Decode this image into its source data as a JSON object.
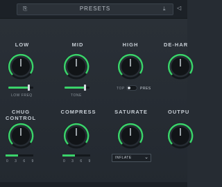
{
  "header": {
    "presets_label": "PRESETS",
    "icons": [
      "save-icon",
      "download-icon",
      "back-icon"
    ]
  },
  "controls": {
    "low": {
      "label": "LOW",
      "slider_label": "LOW FREQ",
      "slider_value": 0.8
    },
    "mid": {
      "label": "MID",
      "slider_label": "TONE",
      "slider_value": 0.8
    },
    "high": {
      "label": "HIGH",
      "toggle_left": "TOP",
      "toggle_right": "PRES",
      "toggle_state": "TOP"
    },
    "deharsh": {
      "label": "DE-HAR"
    },
    "chug": {
      "label_line1": "CHUG",
      "label_line2": "CONTROL",
      "meter_ticks": "0 3 6 9",
      "meter_value": 0.45
    },
    "compress": {
      "label": "COMPRESS",
      "meter_ticks": "0 3 6 9",
      "meter_value": 0.45
    },
    "saturate": {
      "label": "SATURATE",
      "mode": "INFLATE"
    },
    "output": {
      "label": "OUTPU"
    }
  },
  "colors": {
    "accent": "#3ad36a",
    "background": "#262c33"
  }
}
